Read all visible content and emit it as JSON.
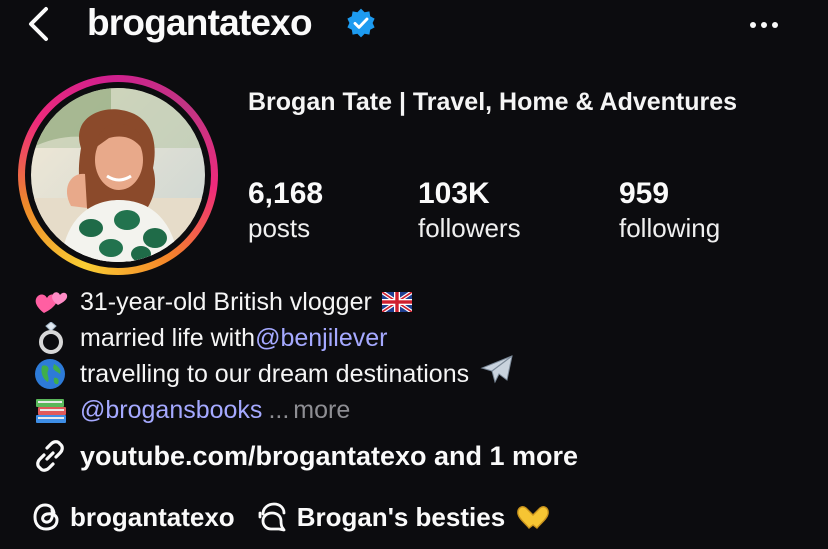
{
  "header": {
    "username": "brogantatexo",
    "back_icon": "chevron-left-icon",
    "verified_icon": "verified-badge-icon",
    "more_icon": "more-horizontal-icon"
  },
  "profile": {
    "full_name": "Brogan Tate | Travel, Home & Adventures",
    "stats": [
      {
        "value": "6,168",
        "label": "posts"
      },
      {
        "value": "103K",
        "label": "followers"
      },
      {
        "value": "959",
        "label": "following"
      }
    ]
  },
  "bio": {
    "line1": {
      "icon": "two-hearts-emoji",
      "text": "31-year-old British vlogger",
      "trailing_icon": "uk-flag-emoji"
    },
    "line2": {
      "icon": "ring-emoji",
      "text": "married life with ",
      "mention": "@benjilever"
    },
    "line3": {
      "icon": "globe-emoji",
      "text": "travelling to our dream destinations",
      "trailing_icon": "airplane-emoji"
    },
    "line4": {
      "icon": "books-emoji",
      "mention": "@brogansbooks",
      "ellipsis": "...",
      "more": "more"
    }
  },
  "link": {
    "icon": "link-icon",
    "text": "youtube.com/brogantatexo and 1 more"
  },
  "threads": {
    "icon": "threads-icon",
    "handle": "brogantatexo"
  },
  "broadcast": {
    "icon": "broadcast-channel-icon",
    "text": "Brogan's besties",
    "trailing_icon": "heart-hands-emoji"
  },
  "colors": {
    "background": "#0c0c0f",
    "mention": "#a5a9ff",
    "verified": "#1d9bf0",
    "muted": "#8e8e93"
  }
}
